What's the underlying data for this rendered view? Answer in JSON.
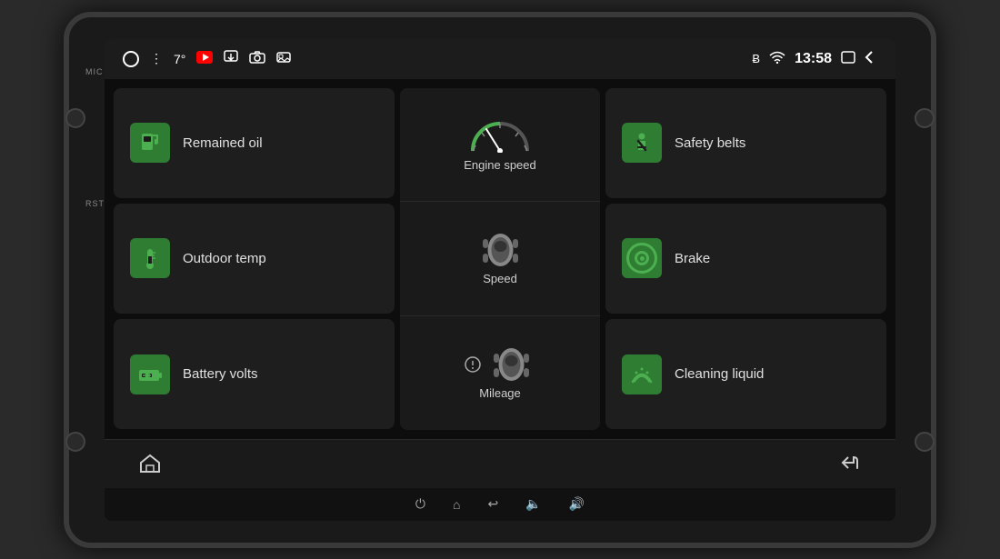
{
  "device": {
    "mic_label": "MIC",
    "rst_label": "RST"
  },
  "status_bar": {
    "temp": "7°",
    "time": "13:58",
    "icons": {
      "home_circle": "○",
      "menu": "⋮",
      "youtube": "▶",
      "photo": "◻",
      "camera": "📷",
      "gallery": "🖼",
      "bluetooth": "Ƀ",
      "wifi": "WiFi",
      "battery_rect": "▭",
      "back_arrow": "◁"
    }
  },
  "tiles": {
    "left": [
      {
        "id": "remained-oil",
        "label": "Remained oil",
        "icon": "fuel"
      },
      {
        "id": "outdoor-temp",
        "label": "Outdoor temp",
        "icon": "thermometer"
      },
      {
        "id": "battery-volts",
        "label": "Battery volts",
        "icon": "battery"
      }
    ],
    "right": [
      {
        "id": "safety-belts",
        "label": "Safety belts",
        "icon": "seatbelt"
      },
      {
        "id": "brake",
        "label": "Brake",
        "icon": "brake"
      },
      {
        "id": "cleaning-liquid",
        "label": "Cleaning liquid",
        "icon": "wiper"
      }
    ]
  },
  "center": {
    "engine_speed_label": "Engine speed",
    "speed_label": "Speed",
    "mileage_label": "Mileage"
  },
  "bottom_nav": {
    "home_label": "⌂",
    "back_label": "↩"
  },
  "system_bar": {
    "power_icon": "⏻",
    "home_icon": "⌂",
    "back_icon": "↩",
    "vol_down_icon": "🔈",
    "vol_up_icon": "🔊"
  }
}
